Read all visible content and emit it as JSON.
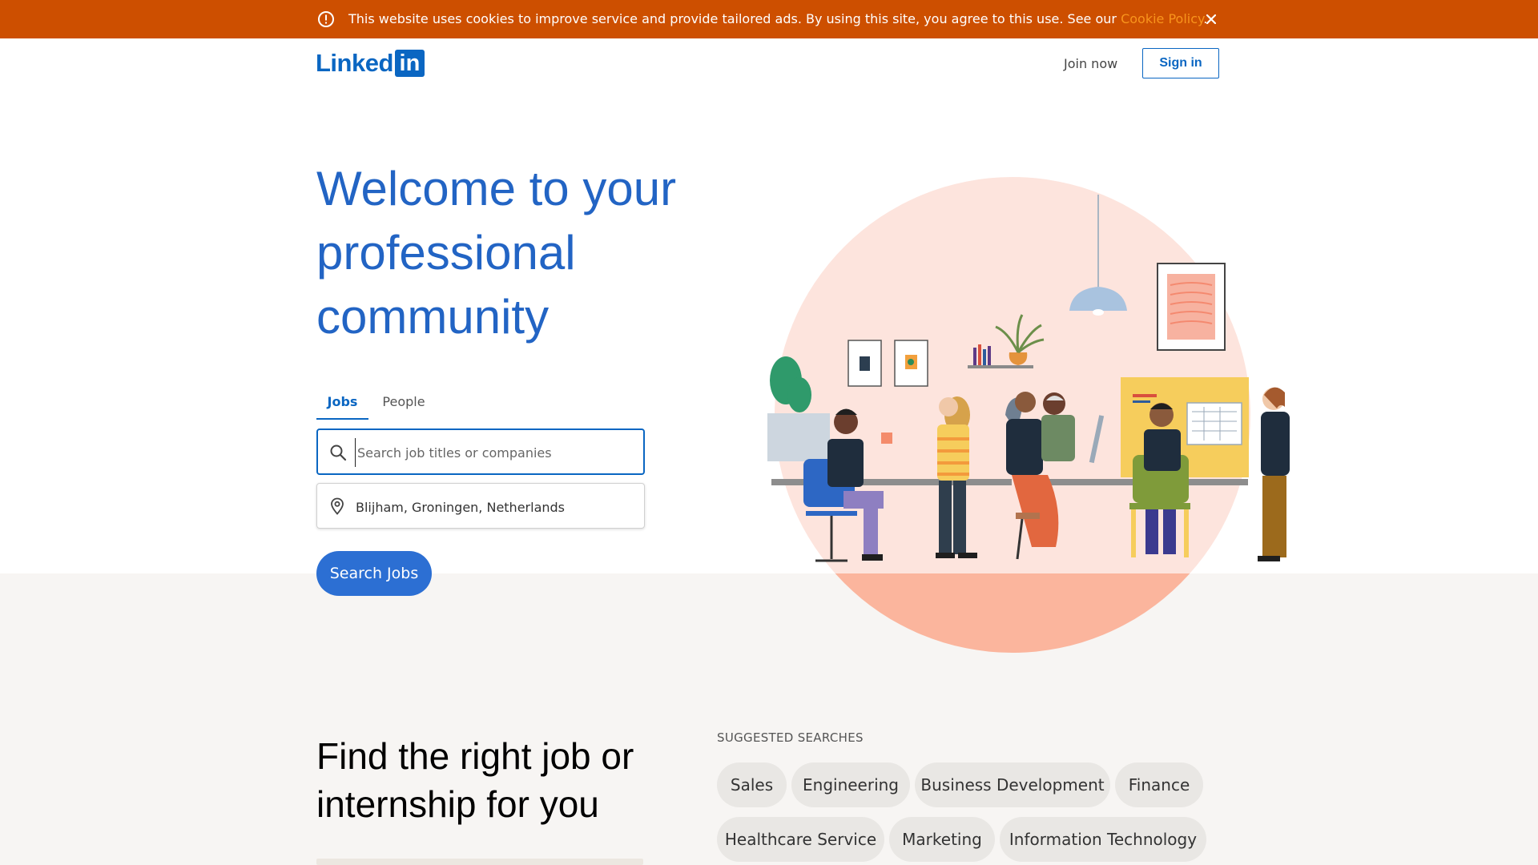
{
  "cookie_banner": {
    "message": "This website uses cookies to improve service and provide tailored ads. By using this site, you agree to this use. See our",
    "link_text": "Cookie Policy",
    "suffix": ".",
    "close_label": "×",
    "background": "#cd4f00"
  },
  "header": {
    "logo_word": "Linked",
    "logo_box": "in",
    "join_now": "Join now",
    "sign_in": "Sign in",
    "brand_color": "#0a66c2"
  },
  "hero": {
    "title_line1": "Welcome to your",
    "title_line2": "professional",
    "title_line3": "community",
    "tabs": [
      {
        "label": "Jobs",
        "active": true
      },
      {
        "label": "People",
        "active": false
      }
    ],
    "search_placeholder": "Search job titles or companies",
    "search_value": "",
    "location_value": "Blijham, Groningen, Netherlands",
    "search_button": "Search Jobs"
  },
  "jobs_section": {
    "title_line1": "Find the right job or",
    "title_line2": "internship for you",
    "suggested_label": "SUGGESTED SEARCHES",
    "suggestions": [
      "Sales",
      "Engineering",
      "Business Development",
      "Finance",
      "Healthcare Service",
      "Marketing",
      "Information Technology"
    ]
  },
  "icons": {
    "alert": "alert-circle-icon",
    "close": "close-icon",
    "search": "search-icon",
    "location": "location-pin-icon"
  }
}
